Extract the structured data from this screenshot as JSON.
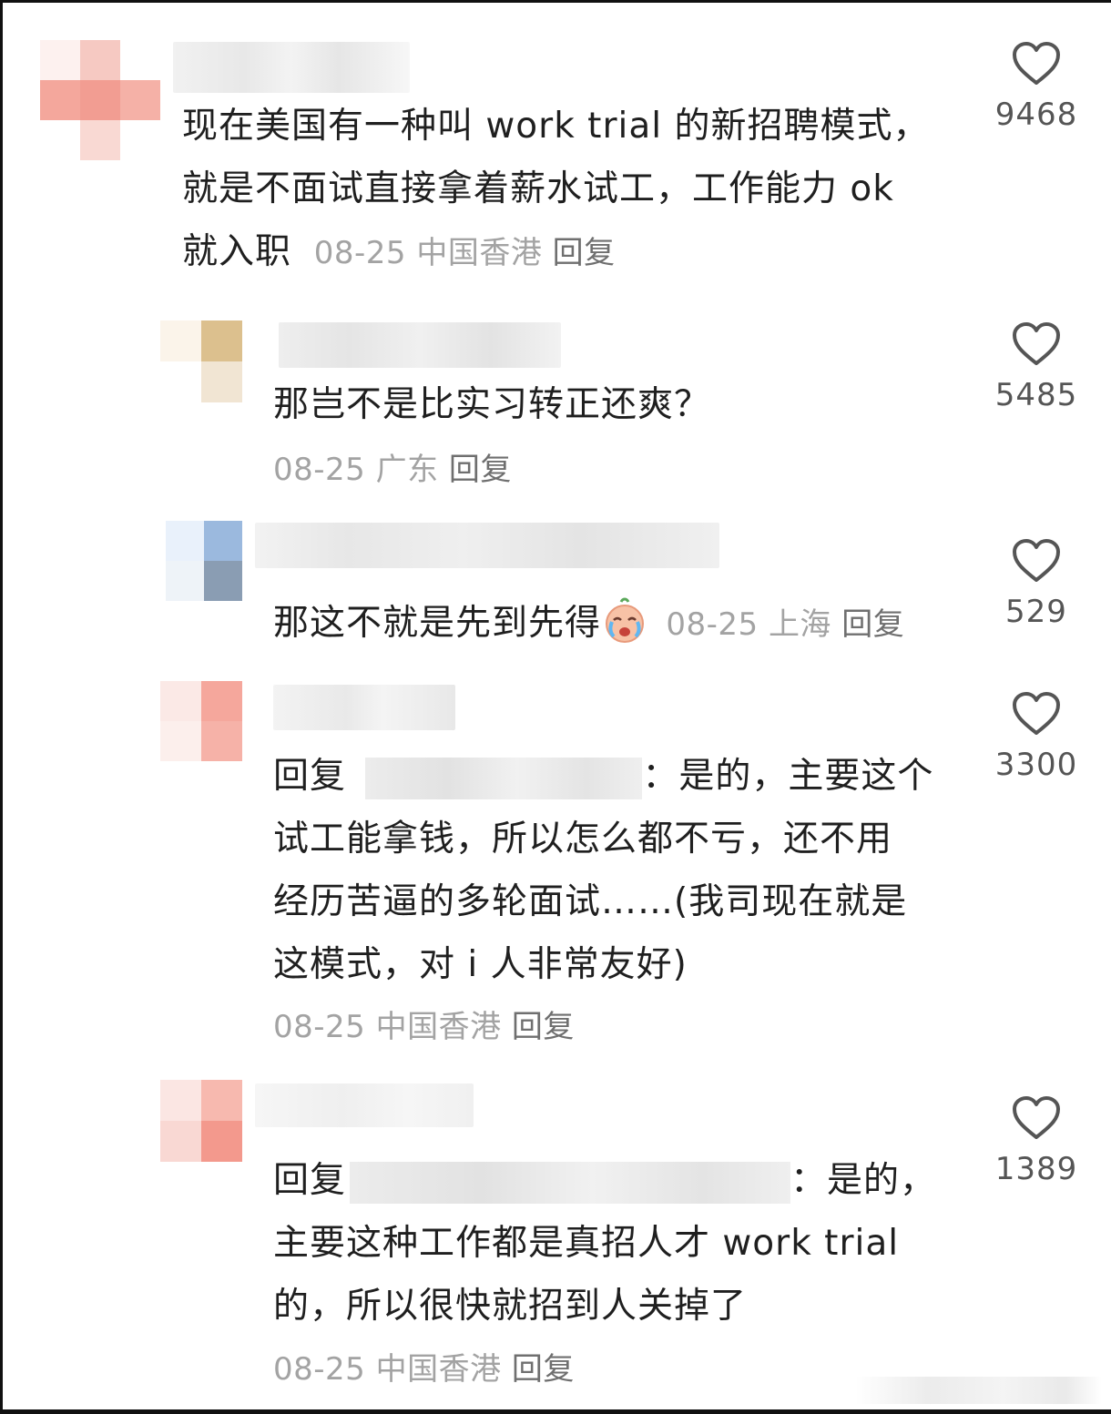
{
  "comments": [
    {
      "text_lines": [
        "现在美国有一种叫 work trial 的新招聘模式，",
        "就是不面试直接拿着薪水试工，工作能力 ok",
        "就入职"
      ],
      "date": "08-25",
      "location": "中国香港",
      "reply_label": "回复",
      "likes": "9468"
    },
    {
      "text_lines": [
        "那岂不是比实习转正还爽？"
      ],
      "date": "08-25",
      "location": "广东",
      "reply_label": "回复",
      "likes": "5485"
    },
    {
      "text": "那这不就是先到先得",
      "emoji": "crying-face-emoji",
      "date": "08-25",
      "location": "上海",
      "reply_label": "回复",
      "likes": "529"
    },
    {
      "reply_prefix": "回复",
      "first_line_rest": "：是的，主要这个",
      "text_lines": [
        "试工能拿钱，所以怎么都不亏，还不用",
        "经历苦逼的多轮面试……(我司现在就是",
        "这模式，对 i 人非常友好)"
      ],
      "date": "08-25",
      "location": "中国香港",
      "reply_label": "回复",
      "likes": "3300"
    },
    {
      "reply_prefix": "回复",
      "first_line_rest": "：是的，",
      "text_lines": [
        "主要这种工作都是真招人才 work trial",
        "的，所以很快就招到人关掉了"
      ],
      "date": "08-25",
      "location": "中国香港",
      "reply_label": "回复",
      "likes": "1389"
    }
  ],
  "icons": {
    "like": "heart-outline-icon"
  },
  "colors": {
    "text": "#1f1f1f",
    "meta": "#a3a3a3",
    "reply": "#6f6f6f",
    "icon": "#555555"
  }
}
